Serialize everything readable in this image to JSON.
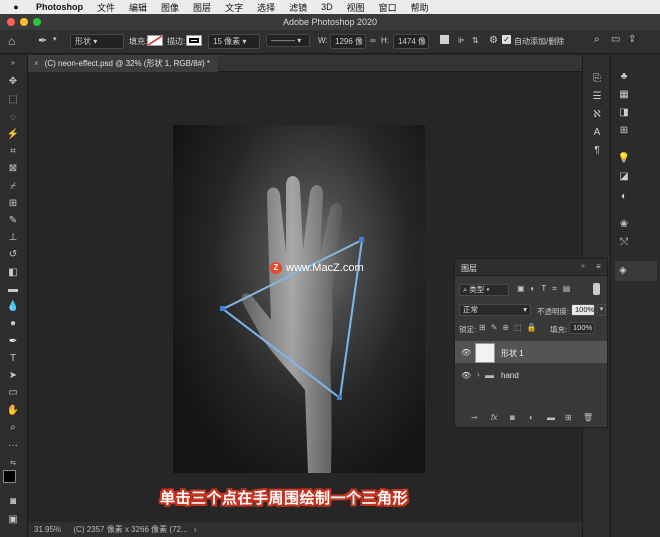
{
  "menubar": {
    "app_name": "Photoshop",
    "items": [
      "文件",
      "编辑",
      "图像",
      "图层",
      "文字",
      "选择",
      "滤镜",
      "3D",
      "视图",
      "窗口",
      "帮助"
    ]
  },
  "window": {
    "title": "Adobe Photoshop 2020"
  },
  "options": {
    "mode": "形状",
    "fill_label": "填充:",
    "stroke_label": "描边:",
    "stroke_width": "15 像素",
    "w_label": "W:",
    "w_value": "1296 像",
    "h_label": "H:",
    "h_value": "1474 像",
    "auto_add_delete": "自动添加/删除"
  },
  "document": {
    "tab_title": "(C) neon-effect.psd @ 32% (形状 1, RGB/8#) *",
    "watermark_text": "www.MacZ.com",
    "caption": "单击三个点在手周围绘制一个三角形"
  },
  "status": {
    "zoom": "31.95%",
    "info": "(C) 2357 像素 x 3266 像素 (72..."
  },
  "layers_panel": {
    "title": "图层",
    "filter_kind": "类型",
    "blend_mode": "正常",
    "opacity_label": "不透明度:",
    "opacity_value": "100%",
    "lock_label": "锁定:",
    "fill_label": "填充:",
    "fill_value": "100%",
    "layers": [
      {
        "name": "形状 1",
        "selected": true
      },
      {
        "name": "hand",
        "selected": false
      }
    ]
  },
  "colors": {
    "path_stroke": "#7fb6e8",
    "anchor": "#3d7ed8",
    "caption_outline": "#c8321e"
  }
}
